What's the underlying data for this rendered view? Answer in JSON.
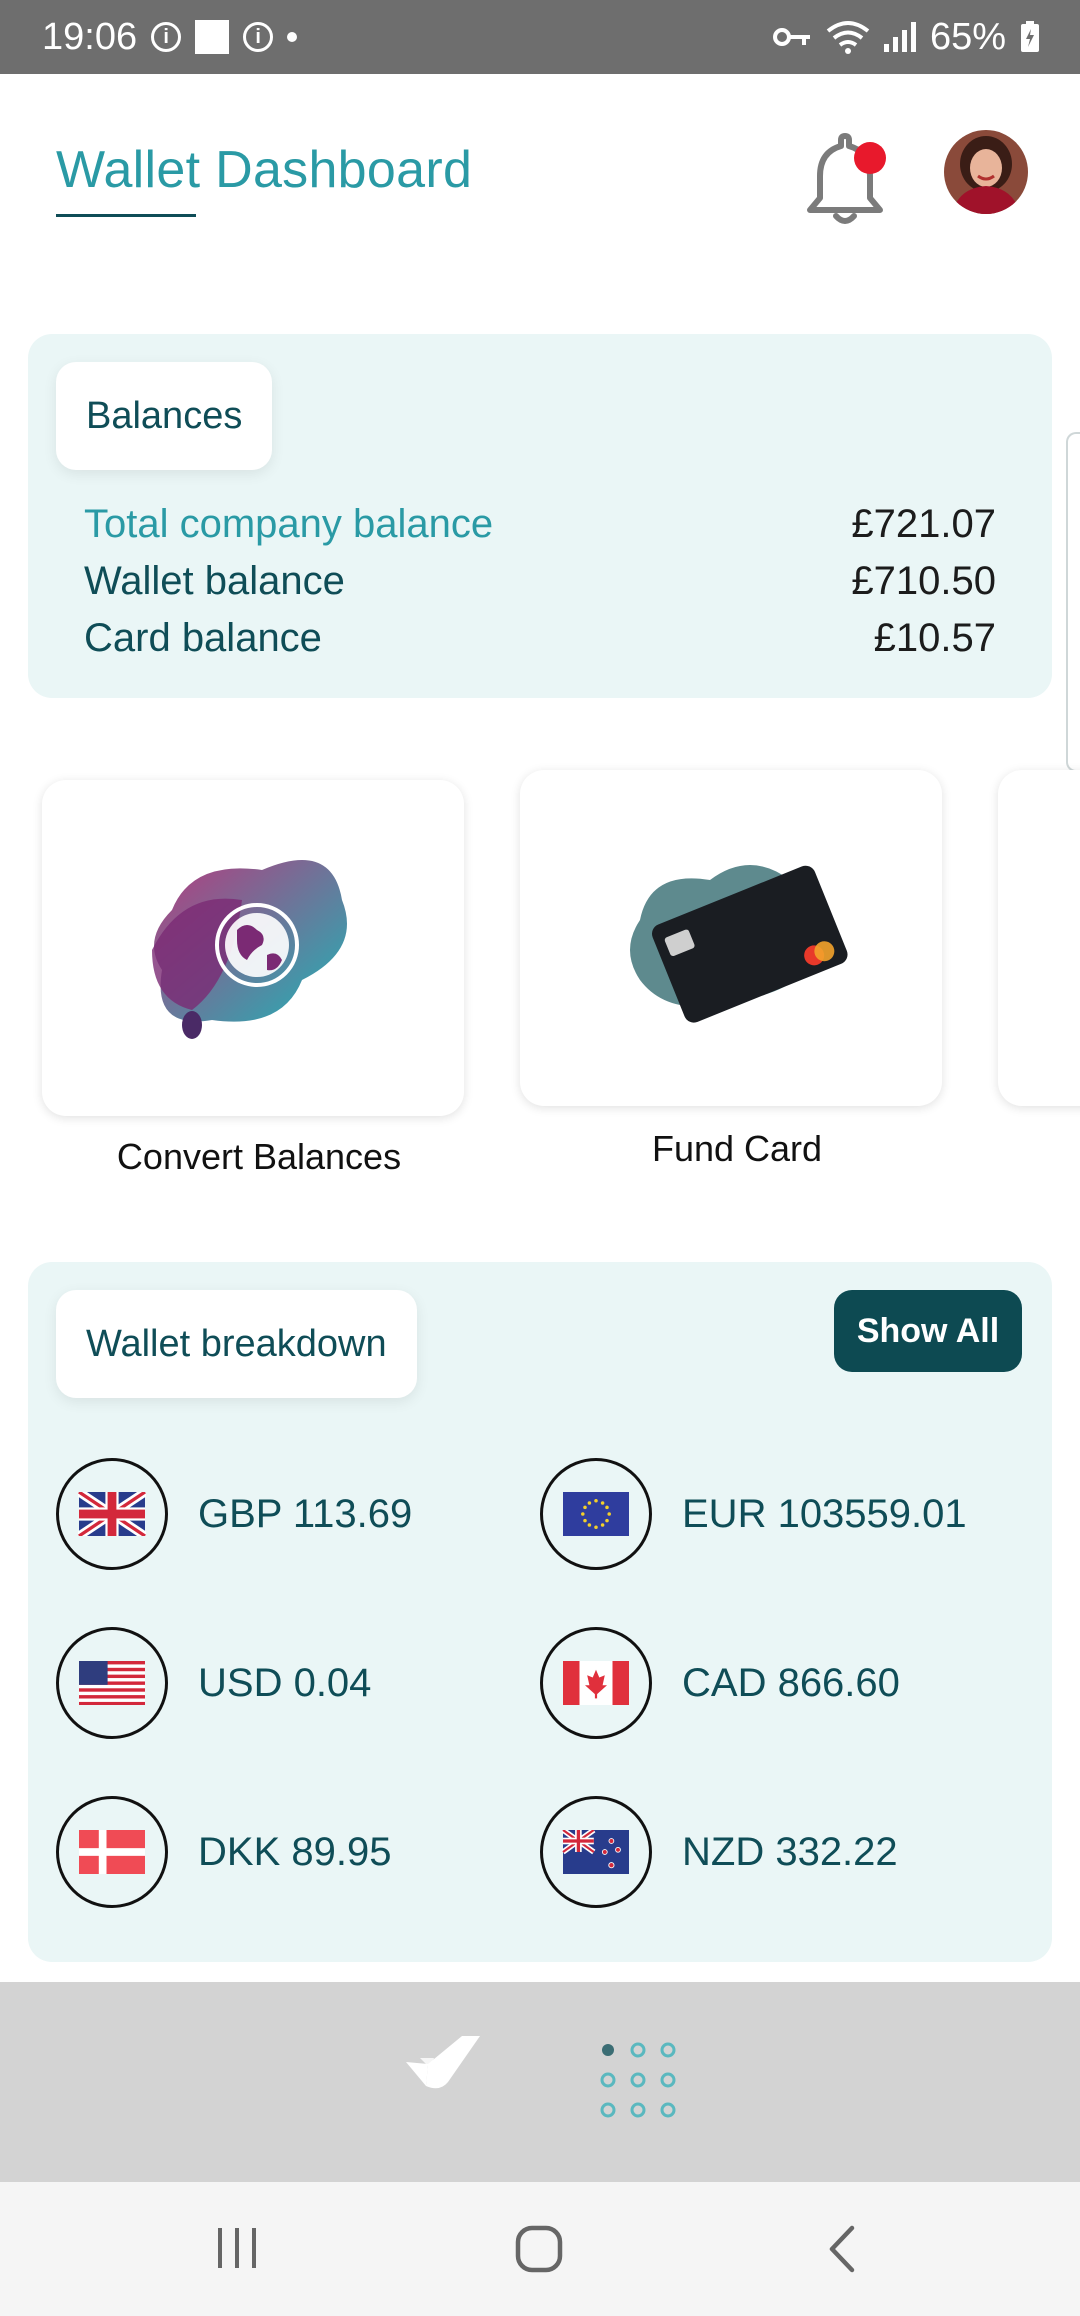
{
  "status_bar": {
    "time": "19:06",
    "battery": "65%"
  },
  "header": {
    "title": "Wallet Dashboard"
  },
  "balances": {
    "heading": "Balances",
    "rows": [
      {
        "label": "Total company balance",
        "amount": "£721.07"
      },
      {
        "label": "Wallet balance",
        "amount": "£710.50"
      },
      {
        "label": "Card balance",
        "amount": "£10.57"
      }
    ]
  },
  "actions": [
    {
      "label": "Convert Balances"
    },
    {
      "label": "Fund Card"
    }
  ],
  "wallet_breakdown": {
    "heading": "Wallet breakdown",
    "show_all_label": "Show All",
    "currencies": [
      {
        "text": "GBP 113.69",
        "flag": "uk-flag-icon"
      },
      {
        "text": "EUR 103559.01",
        "flag": "eu-flag-icon"
      },
      {
        "text": "USD 0.04",
        "flag": "us-flag-icon"
      },
      {
        "text": "CAD 866.60",
        "flag": "canada-flag-icon"
      },
      {
        "text": "DKK 89.95",
        "flag": "denmark-flag-icon"
      },
      {
        "text": "NZD 332.22",
        "flag": "new-zealand-flag-icon"
      }
    ]
  },
  "colors": {
    "accent": "#2a9aa5",
    "dark_teal": "#0d4a52",
    "panel_bg": "#eaf6f6",
    "notification_dot": "#e8192c"
  }
}
